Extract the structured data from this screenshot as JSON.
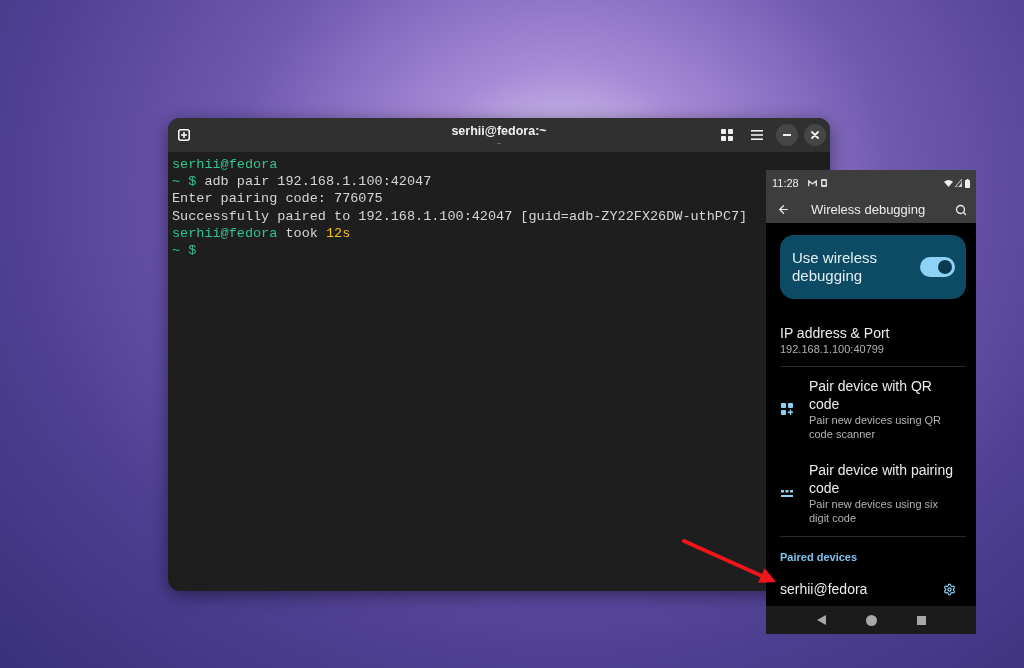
{
  "window": {
    "title": "serhii@fedora:~",
    "subtitle": "~"
  },
  "terminal": {
    "lines": [
      {
        "segments": [
          {
            "kind": "user",
            "text": "serhii@fedora"
          }
        ]
      },
      {
        "segments": [
          {
            "kind": "prompt",
            "text": "~ $"
          },
          {
            "kind": "plain",
            "text": "adb pair 192.168.1.100:42047"
          }
        ]
      },
      {
        "segments": [
          {
            "kind": "plain",
            "text": "Enter pairing code: 776075"
          }
        ]
      },
      {
        "segments": [
          {
            "kind": "plain",
            "text": "Successfully paired to 192.168.1.100:42047 [guid=adb-ZY22FX26DW-uthPC7]"
          }
        ]
      },
      {
        "segments": [
          {
            "kind": "user",
            "text": "serhii@fedora"
          },
          {
            "kind": "plain",
            "text": "took"
          },
          {
            "kind": "duration",
            "text": "12s"
          }
        ]
      },
      {
        "segments": [
          {
            "kind": "prompt",
            "text": "~ $"
          }
        ]
      }
    ]
  },
  "phone": {
    "status_bar": {
      "time": "11:28"
    },
    "app_bar": {
      "title": "Wireless debugging"
    },
    "wireless_debugging": {
      "label": "Use wireless debugging",
      "on": true
    },
    "items": [
      {
        "kind": "info",
        "title": "IP address & Port",
        "subtitle": "192.168.1.100:40799"
      },
      {
        "kind": "qr",
        "title": "Pair device with QR code",
        "subtitle": "Pair new devices using QR code scanner"
      },
      {
        "kind": "code",
        "title": "Pair device with pairing code",
        "subtitle": "Pair new devices using six digit code"
      }
    ],
    "section_title": "Paired devices",
    "paired_devices": [
      {
        "name": "serhii@fedora"
      }
    ]
  }
}
